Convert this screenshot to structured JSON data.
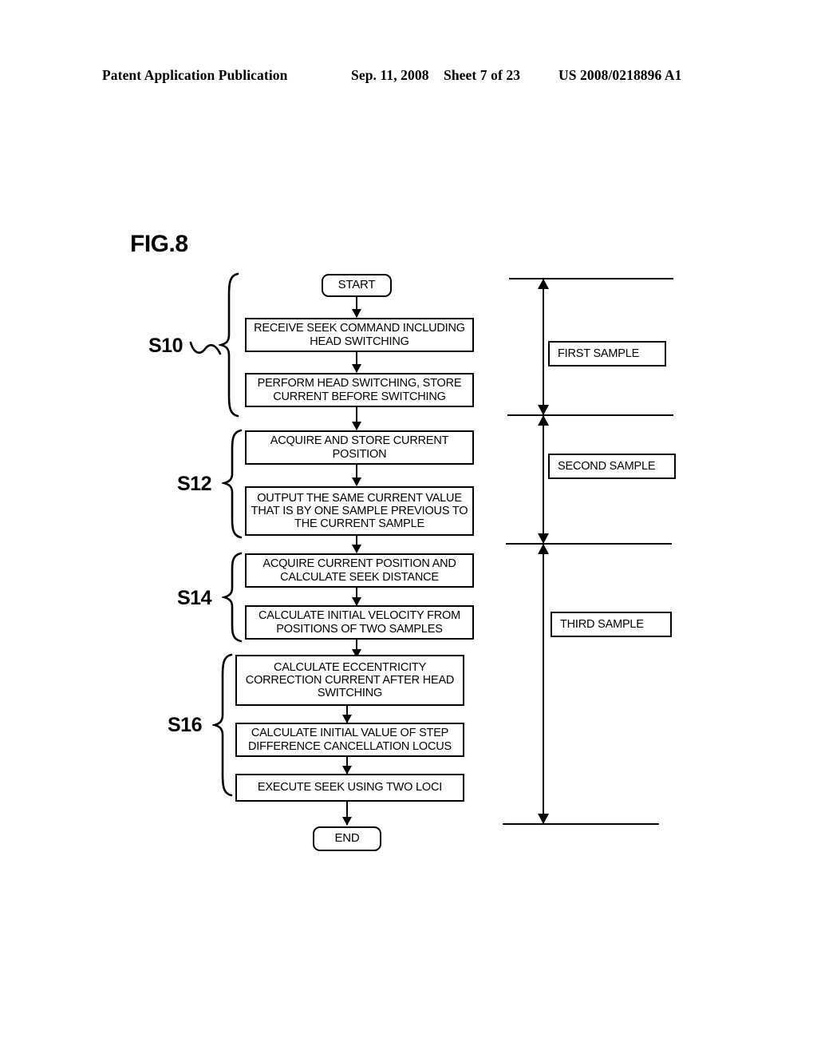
{
  "header": {
    "publication": "Patent Application Publication",
    "date": "Sep. 11, 2008",
    "sheet": "Sheet 7 of 23",
    "patent_number": "US 2008/0218896 A1"
  },
  "figure": {
    "label": "FIG.8"
  },
  "flowchart": {
    "start_label": "START",
    "end_label": "END",
    "steps": [
      {
        "id": "s10",
        "label": "S10"
      },
      {
        "id": "s12",
        "label": "S12"
      },
      {
        "id": "s14",
        "label": "S14"
      },
      {
        "id": "s16",
        "label": "S16"
      }
    ],
    "boxes": [
      {
        "id": "b1",
        "text": "RECEIVE SEEK COMMAND INCLUDING HEAD SWITCHING"
      },
      {
        "id": "b2",
        "text": "PERFORM HEAD SWITCHING, STORE CURRENT BEFORE SWITCHING"
      },
      {
        "id": "b3",
        "text": "ACQUIRE AND STORE CURRENT POSITION"
      },
      {
        "id": "b4",
        "text": "OUTPUT THE SAME CURRENT VALUE THAT IS BY ONE SAMPLE PREVIOUS TO THE CURRENT SAMPLE"
      },
      {
        "id": "b5",
        "text": "ACQUIRE CURRENT POSITION AND CALCULATE SEEK DISTANCE"
      },
      {
        "id": "b6",
        "text": "CALCULATE INITIAL VELOCITY FROM POSITIONS OF TWO SAMPLES"
      },
      {
        "id": "b7",
        "text": "CALCULATE ECCENTRICITY CORRECTION CURRENT AFTER HEAD SWITCHING"
      },
      {
        "id": "b8",
        "text": "CALCULATE INITIAL VALUE OF STEP DIFFERENCE CANCELLATION LOCUS"
      },
      {
        "id": "b9",
        "text": "EXECUTE SEEK USING TWO LOCI"
      }
    ]
  },
  "samples": [
    {
      "id": "first",
      "label": "FIRST SAMPLE"
    },
    {
      "id": "second",
      "label": "SECOND SAMPLE"
    },
    {
      "id": "third",
      "label": "THIRD SAMPLE"
    }
  ],
  "colors": {
    "ink": "#000000",
    "paper": "#ffffff"
  }
}
